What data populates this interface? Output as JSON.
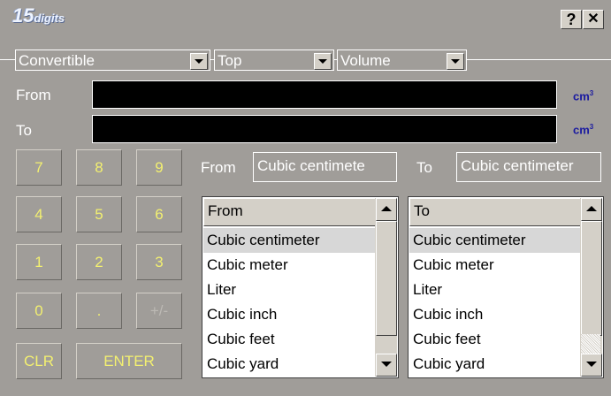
{
  "app": {
    "logo_number": "15",
    "logo_word": "digits",
    "help_label": "?",
    "close_label": "✕"
  },
  "selectors": {
    "mode": "Convertible",
    "position": "Top",
    "category": "Volume"
  },
  "display": {
    "from_label": "From",
    "to_label": "To",
    "from_value": "",
    "to_value": "",
    "unit_base": "cm",
    "unit_exp": "3"
  },
  "keypad": {
    "keys": [
      "7",
      "8",
      "9",
      "4",
      "5",
      "6",
      "1",
      "2",
      "3",
      "0",
      ".",
      "+/-"
    ],
    "clear": "CLR",
    "enter": "ENTER"
  },
  "units": {
    "from_label": "From",
    "from_value": "Cubic centimete",
    "to_label": "To",
    "to_value": "Cubic centimeter"
  },
  "lists": {
    "from_header": "From",
    "to_header": "To",
    "items": [
      "Cubic centimeter",
      "Cubic meter",
      "Liter",
      "Cubic inch",
      "Cubic feet",
      "Cubic yard"
    ],
    "selected_from": "Cubic centimeter",
    "selected_to": "Cubic centimeter"
  }
}
